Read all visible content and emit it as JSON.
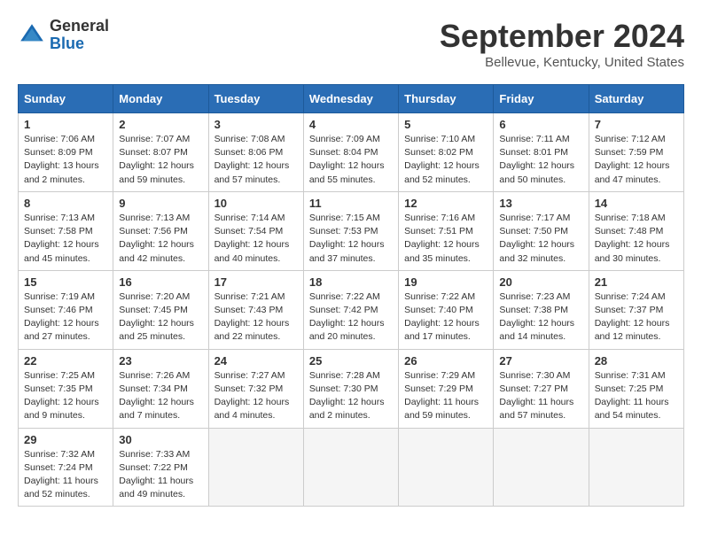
{
  "logo": {
    "general": "General",
    "blue": "Blue"
  },
  "title": "September 2024",
  "subtitle": "Bellevue, Kentucky, United States",
  "headers": [
    "Sunday",
    "Monday",
    "Tuesday",
    "Wednesday",
    "Thursday",
    "Friday",
    "Saturday"
  ],
  "weeks": [
    [
      {
        "day": "1",
        "sunrise": "Sunrise: 7:06 AM",
        "sunset": "Sunset: 8:09 PM",
        "daylight": "Daylight: 13 hours and 2 minutes."
      },
      {
        "day": "2",
        "sunrise": "Sunrise: 7:07 AM",
        "sunset": "Sunset: 8:07 PM",
        "daylight": "Daylight: 12 hours and 59 minutes."
      },
      {
        "day": "3",
        "sunrise": "Sunrise: 7:08 AM",
        "sunset": "Sunset: 8:06 PM",
        "daylight": "Daylight: 12 hours and 57 minutes."
      },
      {
        "day": "4",
        "sunrise": "Sunrise: 7:09 AM",
        "sunset": "Sunset: 8:04 PM",
        "daylight": "Daylight: 12 hours and 55 minutes."
      },
      {
        "day": "5",
        "sunrise": "Sunrise: 7:10 AM",
        "sunset": "Sunset: 8:02 PM",
        "daylight": "Daylight: 12 hours and 52 minutes."
      },
      {
        "day": "6",
        "sunrise": "Sunrise: 7:11 AM",
        "sunset": "Sunset: 8:01 PM",
        "daylight": "Daylight: 12 hours and 50 minutes."
      },
      {
        "day": "7",
        "sunrise": "Sunrise: 7:12 AM",
        "sunset": "Sunset: 7:59 PM",
        "daylight": "Daylight: 12 hours and 47 minutes."
      }
    ],
    [
      {
        "day": "8",
        "sunrise": "Sunrise: 7:13 AM",
        "sunset": "Sunset: 7:58 PM",
        "daylight": "Daylight: 12 hours and 45 minutes."
      },
      {
        "day": "9",
        "sunrise": "Sunrise: 7:13 AM",
        "sunset": "Sunset: 7:56 PM",
        "daylight": "Daylight: 12 hours and 42 minutes."
      },
      {
        "day": "10",
        "sunrise": "Sunrise: 7:14 AM",
        "sunset": "Sunset: 7:54 PM",
        "daylight": "Daylight: 12 hours and 40 minutes."
      },
      {
        "day": "11",
        "sunrise": "Sunrise: 7:15 AM",
        "sunset": "Sunset: 7:53 PM",
        "daylight": "Daylight: 12 hours and 37 minutes."
      },
      {
        "day": "12",
        "sunrise": "Sunrise: 7:16 AM",
        "sunset": "Sunset: 7:51 PM",
        "daylight": "Daylight: 12 hours and 35 minutes."
      },
      {
        "day": "13",
        "sunrise": "Sunrise: 7:17 AM",
        "sunset": "Sunset: 7:50 PM",
        "daylight": "Daylight: 12 hours and 32 minutes."
      },
      {
        "day": "14",
        "sunrise": "Sunrise: 7:18 AM",
        "sunset": "Sunset: 7:48 PM",
        "daylight": "Daylight: 12 hours and 30 minutes."
      }
    ],
    [
      {
        "day": "15",
        "sunrise": "Sunrise: 7:19 AM",
        "sunset": "Sunset: 7:46 PM",
        "daylight": "Daylight: 12 hours and 27 minutes."
      },
      {
        "day": "16",
        "sunrise": "Sunrise: 7:20 AM",
        "sunset": "Sunset: 7:45 PM",
        "daylight": "Daylight: 12 hours and 25 minutes."
      },
      {
        "day": "17",
        "sunrise": "Sunrise: 7:21 AM",
        "sunset": "Sunset: 7:43 PM",
        "daylight": "Daylight: 12 hours and 22 minutes."
      },
      {
        "day": "18",
        "sunrise": "Sunrise: 7:22 AM",
        "sunset": "Sunset: 7:42 PM",
        "daylight": "Daylight: 12 hours and 20 minutes."
      },
      {
        "day": "19",
        "sunrise": "Sunrise: 7:22 AM",
        "sunset": "Sunset: 7:40 PM",
        "daylight": "Daylight: 12 hours and 17 minutes."
      },
      {
        "day": "20",
        "sunrise": "Sunrise: 7:23 AM",
        "sunset": "Sunset: 7:38 PM",
        "daylight": "Daylight: 12 hours and 14 minutes."
      },
      {
        "day": "21",
        "sunrise": "Sunrise: 7:24 AM",
        "sunset": "Sunset: 7:37 PM",
        "daylight": "Daylight: 12 hours and 12 minutes."
      }
    ],
    [
      {
        "day": "22",
        "sunrise": "Sunrise: 7:25 AM",
        "sunset": "Sunset: 7:35 PM",
        "daylight": "Daylight: 12 hours and 9 minutes."
      },
      {
        "day": "23",
        "sunrise": "Sunrise: 7:26 AM",
        "sunset": "Sunset: 7:34 PM",
        "daylight": "Daylight: 12 hours and 7 minutes."
      },
      {
        "day": "24",
        "sunrise": "Sunrise: 7:27 AM",
        "sunset": "Sunset: 7:32 PM",
        "daylight": "Daylight: 12 hours and 4 minutes."
      },
      {
        "day": "25",
        "sunrise": "Sunrise: 7:28 AM",
        "sunset": "Sunset: 7:30 PM",
        "daylight": "Daylight: 12 hours and 2 minutes."
      },
      {
        "day": "26",
        "sunrise": "Sunrise: 7:29 AM",
        "sunset": "Sunset: 7:29 PM",
        "daylight": "Daylight: 11 hours and 59 minutes."
      },
      {
        "day": "27",
        "sunrise": "Sunrise: 7:30 AM",
        "sunset": "Sunset: 7:27 PM",
        "daylight": "Daylight: 11 hours and 57 minutes."
      },
      {
        "day": "28",
        "sunrise": "Sunrise: 7:31 AM",
        "sunset": "Sunset: 7:25 PM",
        "daylight": "Daylight: 11 hours and 54 minutes."
      }
    ],
    [
      {
        "day": "29",
        "sunrise": "Sunrise: 7:32 AM",
        "sunset": "Sunset: 7:24 PM",
        "daylight": "Daylight: 11 hours and 52 minutes."
      },
      {
        "day": "30",
        "sunrise": "Sunrise: 7:33 AM",
        "sunset": "Sunset: 7:22 PM",
        "daylight": "Daylight: 11 hours and 49 minutes."
      },
      null,
      null,
      null,
      null,
      null
    ]
  ]
}
